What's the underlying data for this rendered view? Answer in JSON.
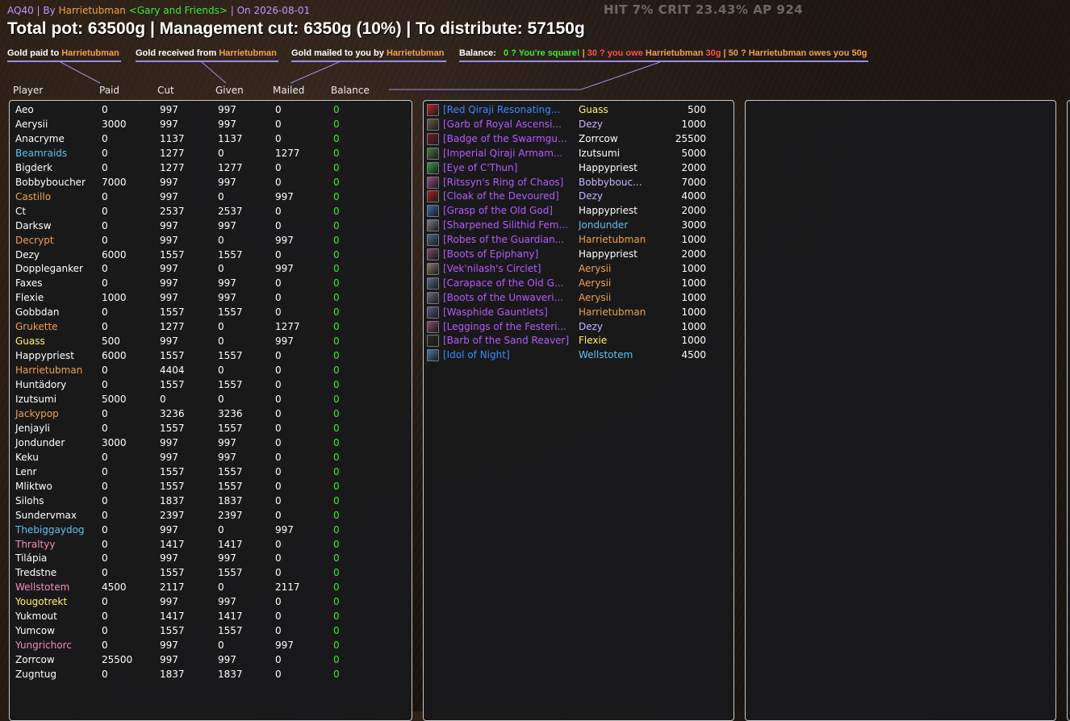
{
  "header": {
    "raid": "AQ40",
    "by_label": "| By",
    "author": "Harrietubman",
    "guild": "<Gary and Friends>",
    "date_label": "| On 2026-08-01",
    "stats": "HIT  7%  CRIT  23.43%   AP  924",
    "summary": "Total pot: 63500g | Management cut: 6350g (10%) | To distribute: 57150g"
  },
  "legend": {
    "paid_label": "Gold paid to",
    "received_label": "Gold received from",
    "mailed_label": "Gold mailed to you by",
    "player": "Harrietubman",
    "balance_label": "Balance:",
    "square": "0 ? You're square!",
    "sep": "|",
    "owe_prefix": "30 ? you owe",
    "owe_amount": "30g",
    "owes_prefix": "50 ? Harrietubman owes you",
    "owes_amount": "50g"
  },
  "columns": {
    "player": "Player",
    "paid": "Paid",
    "cut": "Cut",
    "given": "Given",
    "mailed": "Mailed",
    "balance": "Balance"
  },
  "colors": {
    "white": "#ffffff",
    "orange": "#f0a050",
    "blue": "#5fc1ea",
    "pink": "#f58cba",
    "yellow": "#fff569",
    "green": "#3ee83e",
    "epic": "#b35cff",
    "rare": "#3a8cff"
  },
  "players": [
    {
      "name": "Aeo",
      "paid": "0",
      "cut": "997",
      "given": "997",
      "mailed": "0",
      "balance": "0",
      "color": "#ffffff"
    },
    {
      "name": "Aerysii",
      "paid": "3000",
      "cut": "997",
      "given": "997",
      "mailed": "0",
      "balance": "0",
      "color": "#ffffff"
    },
    {
      "name": "Anacryme",
      "paid": "0",
      "cut": "1137",
      "given": "1137",
      "mailed": "0",
      "balance": "0",
      "color": "#ffffff"
    },
    {
      "name": "Beamraids",
      "paid": "0",
      "cut": "1277",
      "given": "0",
      "mailed": "1277",
      "balance": "0",
      "color": "#5fc1ea"
    },
    {
      "name": "Bigderk",
      "paid": "0",
      "cut": "1277",
      "given": "1277",
      "mailed": "0",
      "balance": "0",
      "color": "#ffffff"
    },
    {
      "name": "Bobbyboucher",
      "paid": "7000",
      "cut": "997",
      "given": "997",
      "mailed": "0",
      "balance": "0",
      "color": "#ffffff"
    },
    {
      "name": "Castillo",
      "paid": "0",
      "cut": "997",
      "given": "0",
      "mailed": "997",
      "balance": "0",
      "color": "#f0a050"
    },
    {
      "name": "Ct",
      "paid": "0",
      "cut": "2537",
      "given": "2537",
      "mailed": "0",
      "balance": "0",
      "color": "#ffffff"
    },
    {
      "name": "Darksw",
      "paid": "0",
      "cut": "997",
      "given": "997",
      "mailed": "0",
      "balance": "0",
      "color": "#ffffff"
    },
    {
      "name": "Decrypt",
      "paid": "0",
      "cut": "997",
      "given": "0",
      "mailed": "997",
      "balance": "0",
      "color": "#f0a050"
    },
    {
      "name": "Dezy",
      "paid": "6000",
      "cut": "1557",
      "given": "1557",
      "mailed": "0",
      "balance": "0",
      "color": "#ffffff"
    },
    {
      "name": "Doppleganker",
      "paid": "0",
      "cut": "997",
      "given": "0",
      "mailed": "997",
      "balance": "0",
      "color": "#ffffff"
    },
    {
      "name": "Faxes",
      "paid": "0",
      "cut": "997",
      "given": "997",
      "mailed": "0",
      "balance": "0",
      "color": "#ffffff"
    },
    {
      "name": "Flexie",
      "paid": "1000",
      "cut": "997",
      "given": "997",
      "mailed": "0",
      "balance": "0",
      "color": "#ffffff"
    },
    {
      "name": "Gobbdan",
      "paid": "0",
      "cut": "1557",
      "given": "1557",
      "mailed": "0",
      "balance": "0",
      "color": "#ffffff"
    },
    {
      "name": "Grukette",
      "paid": "0",
      "cut": "1277",
      "given": "0",
      "mailed": "1277",
      "balance": "0",
      "color": "#f0a050"
    },
    {
      "name": "Guass",
      "paid": "500",
      "cut": "997",
      "given": "0",
      "mailed": "997",
      "balance": "0",
      "color": "#fff569"
    },
    {
      "name": "Happypriest",
      "paid": "6000",
      "cut": "1557",
      "given": "1557",
      "mailed": "0",
      "balance": "0",
      "color": "#ffffff"
    },
    {
      "name": "Harrietubman",
      "paid": "0",
      "cut": "4404",
      "given": "0",
      "mailed": "0",
      "balance": "0",
      "color": "#f0a050"
    },
    {
      "name": "Huntädory",
      "paid": "0",
      "cut": "1557",
      "given": "1557",
      "mailed": "0",
      "balance": "0",
      "color": "#ffffff"
    },
    {
      "name": "Izutsumi",
      "paid": "5000",
      "cut": "0",
      "given": "0",
      "mailed": "0",
      "balance": "0",
      "color": "#ffffff"
    },
    {
      "name": "Jackypop",
      "paid": "0",
      "cut": "3236",
      "given": "3236",
      "mailed": "0",
      "balance": "0",
      "color": "#f0a050"
    },
    {
      "name": "Jenjayli",
      "paid": "0",
      "cut": "1557",
      "given": "1557",
      "mailed": "0",
      "balance": "0",
      "color": "#ffffff"
    },
    {
      "name": "Jondunder",
      "paid": "3000",
      "cut": "997",
      "given": "997",
      "mailed": "0",
      "balance": "0",
      "color": "#ffffff"
    },
    {
      "name": "Keku",
      "paid": "0",
      "cut": "997",
      "given": "997",
      "mailed": "0",
      "balance": "0",
      "color": "#ffffff"
    },
    {
      "name": "Lenr",
      "paid": "0",
      "cut": "1557",
      "given": "1557",
      "mailed": "0",
      "balance": "0",
      "color": "#ffffff"
    },
    {
      "name": "Mliktwo",
      "paid": "0",
      "cut": "1557",
      "given": "1557",
      "mailed": "0",
      "balance": "0",
      "color": "#ffffff"
    },
    {
      "name": "Silohs",
      "paid": "0",
      "cut": "1837",
      "given": "1837",
      "mailed": "0",
      "balance": "0",
      "color": "#ffffff"
    },
    {
      "name": "Sundervmax",
      "paid": "0",
      "cut": "2397",
      "given": "2397",
      "mailed": "0",
      "balance": "0",
      "color": "#ffffff"
    },
    {
      "name": "Thebiggaydog",
      "paid": "0",
      "cut": "997",
      "given": "0",
      "mailed": "997",
      "balance": "0",
      "color": "#5fc1ea"
    },
    {
      "name": "Thraltyy",
      "paid": "0",
      "cut": "1417",
      "given": "1417",
      "mailed": "0",
      "balance": "0",
      "color": "#f58cba"
    },
    {
      "name": "Tilápia",
      "paid": "0",
      "cut": "997",
      "given": "997",
      "mailed": "0",
      "balance": "0",
      "color": "#ffffff"
    },
    {
      "name": "Tredstne",
      "paid": "0",
      "cut": "1557",
      "given": "1557",
      "mailed": "0",
      "balance": "0",
      "color": "#ffffff"
    },
    {
      "name": "Wellstotem",
      "paid": "4500",
      "cut": "2117",
      "given": "0",
      "mailed": "2117",
      "balance": "0",
      "color": "#f58cba"
    },
    {
      "name": "Yougotrekt",
      "paid": "0",
      "cut": "997",
      "given": "997",
      "mailed": "0",
      "balance": "0",
      "color": "#fff569"
    },
    {
      "name": "Yukmout",
      "paid": "0",
      "cut": "1417",
      "given": "1417",
      "mailed": "0",
      "balance": "0",
      "color": "#ffffff"
    },
    {
      "name": "Yumcow",
      "paid": "0",
      "cut": "1557",
      "given": "1557",
      "mailed": "0",
      "balance": "0",
      "color": "#ffffff"
    },
    {
      "name": "Yungrichorc",
      "paid": "0",
      "cut": "997",
      "given": "0",
      "mailed": "997",
      "balance": "0",
      "color": "#f58cba"
    },
    {
      "name": "Zorrcow",
      "paid": "25500",
      "cut": "997",
      "given": "997",
      "mailed": "0",
      "balance": "0",
      "color": "#ffffff"
    },
    {
      "name": "Zugntug",
      "paid": "0",
      "cut": "1837",
      "given": "1837",
      "mailed": "0",
      "balance": "0",
      "color": "#ffffff"
    }
  ],
  "items": [
    {
      "name": "[Red Qiraji Resonating...",
      "winner": "Guass",
      "price": "500",
      "item_color": "#3a8cff",
      "winner_color": "#fff569",
      "icon": "red-crystal-icon",
      "icon_color": "#b8262a"
    },
    {
      "name": "[Garb of Royal Ascensi...",
      "winner": "Dezy",
      "price": "1000",
      "item_color": "#b35cff",
      "winner_color": "#c8b4ff",
      "icon": "robe-icon",
      "icon_color": "#6a5a4a"
    },
    {
      "name": "[Badge of the Swarmgu...",
      "winner": "Zorrcow",
      "price": "25500",
      "item_color": "#b35cff",
      "winner_color": "#ffffff",
      "icon": "badge-icon",
      "icon_color": "#7a2020"
    },
    {
      "name": "[Imperial Qiraji Armam...",
      "winner": "Izutsumi",
      "price": "5000",
      "item_color": "#b35cff",
      "winner_color": "#ffffff",
      "icon": "scarab-icon",
      "icon_color": "#4a7a3a"
    },
    {
      "name": "[Eye of C'Thun]",
      "winner": "Happypriest",
      "price": "2000",
      "item_color": "#b35cff",
      "winner_color": "#ffffff",
      "icon": "eye-icon",
      "icon_color": "#3a9a4a"
    },
    {
      "name": "[Ritssyn's Ring of Chaos]",
      "winner": "Bobbybouc...",
      "price": "7000",
      "item_color": "#b35cff",
      "winner_color": "#c8b4ff",
      "icon": "ring-icon",
      "icon_color": "#9a4a8a"
    },
    {
      "name": "[Cloak of the Devoured]",
      "winner": "Dezy",
      "price": "4000",
      "item_color": "#b35cff",
      "winner_color": "#c8b4ff",
      "icon": "cloak-icon",
      "icon_color": "#a82020"
    },
    {
      "name": "[Grasp of the Old God]",
      "winner": "Happypriest",
      "price": "2000",
      "item_color": "#b35cff",
      "winner_color": "#ffffff",
      "icon": "staff-icon",
      "icon_color": "#3a6aa8"
    },
    {
      "name": "[Sharpened Silithid Fem...",
      "winner": "Jondunder",
      "price": "3000",
      "item_color": "#b35cff",
      "winner_color": "#5fc1ea",
      "icon": "dagger-icon",
      "icon_color": "#7a7a8a"
    },
    {
      "name": "[Robes of the Guardian...",
      "winner": "Harrietubman",
      "price": "1000",
      "item_color": "#b35cff",
      "winner_color": "#f0a050",
      "icon": "robe-icon",
      "icon_color": "#4a6a8a"
    },
    {
      "name": "[Boots of Epiphany]",
      "winner": "Happypriest",
      "price": "2000",
      "item_color": "#b35cff",
      "winner_color": "#ffffff",
      "icon": "boots-icon",
      "icon_color": "#7a4a6a"
    },
    {
      "name": "[Vek'nilash's Circlet]",
      "winner": "Aerysii",
      "price": "1000",
      "item_color": "#b35cff",
      "winner_color": "#f0a050",
      "icon": "circlet-icon",
      "icon_color": "#8a7a6a"
    },
    {
      "name": "[Carapace of the Old G...",
      "winner": "Aerysii",
      "price": "1000",
      "item_color": "#b35cff",
      "winner_color": "#f0a050",
      "icon": "chest-icon",
      "icon_color": "#5a6a8a"
    },
    {
      "name": "[Boots of the Unwaveri...",
      "winner": "Aerysii",
      "price": "1000",
      "item_color": "#b35cff",
      "winner_color": "#f0a050",
      "icon": "boots-icon",
      "icon_color": "#6a6a7a"
    },
    {
      "name": "[Wasphide Gauntlets]",
      "winner": "Harrietubman",
      "price": "1000",
      "item_color": "#b35cff",
      "winner_color": "#f0a050",
      "icon": "gauntlets-icon",
      "icon_color": "#5a5a8a"
    },
    {
      "name": "[Leggings of the Festeri...",
      "winner": "Dezy",
      "price": "1000",
      "item_color": "#b35cff",
      "winner_color": "#c8b4ff",
      "icon": "leggings-icon",
      "icon_color": "#8a4a6a"
    },
    {
      "name": "[Barb of the Sand Reaver]",
      "winner": "Flexie",
      "price": "1000",
      "item_color": "#b35cff",
      "winner_color": "#fff569",
      "icon": "polearm-icon",
      "icon_color": "#2a2a2a"
    },
    {
      "name": "[Idol of Night]",
      "winner": "Wellstotem",
      "price": "4500",
      "item_color": "#3a8cff",
      "winner_color": "#5fc1ea",
      "icon": "idol-icon",
      "icon_color": "#4a7aa8"
    }
  ]
}
